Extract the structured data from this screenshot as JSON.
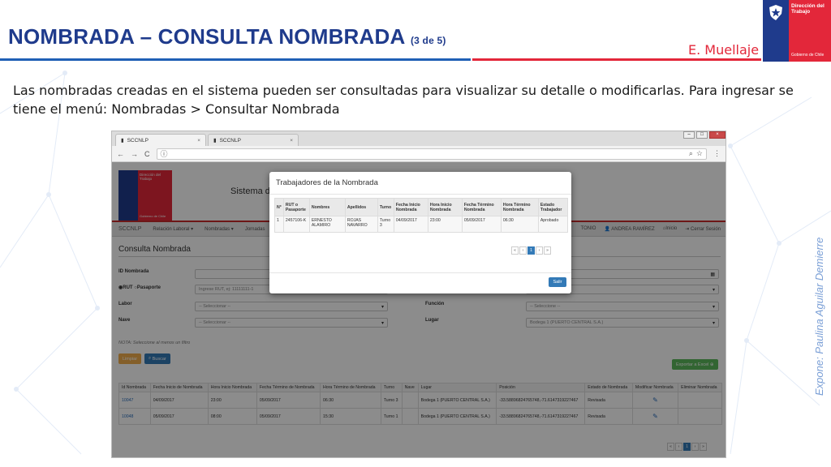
{
  "slide": {
    "title": "NOMBRADA – CONSULTA NOMBRADA",
    "title_suffix": "(3 de 5)",
    "author": "E. Muellaje",
    "logo_org_name": "Dirección del Trabajo",
    "logo_gov": "Gobierno de Chile",
    "intro_text": "Las nombradas creadas en el sistema pueden ser consultadas para visualizar su detalle o modificarlas. Para ingresar se tiene el menú: Nombradas > Consultar Nombrada",
    "side_credit": "Expone: Paulina Aguilar Demierre",
    "colors": {
      "navy": "#1f3b8c",
      "red": "#e3273a",
      "accent_blue": "#1f5fb5"
    }
  },
  "browser": {
    "tabs": [
      {
        "label": "SCCNLP",
        "close": "×"
      },
      {
        "label": "SCCNLP",
        "close": "×"
      }
    ],
    "nav_icons": {
      "back": "←",
      "forward": "→",
      "reload": "C",
      "info": "ⓘ"
    },
    "window_controls": [
      "–",
      "□",
      "×"
    ]
  },
  "app": {
    "logo_org_name": "Dirección del Trabajo",
    "logo_gov": "Gobierno de Chile",
    "title_partial": "Sistema de",
    "brand": "SCCNLP",
    "nav_items": [
      "Relación Laboral ▾",
      "Nombradas ▾",
      "Jornadas"
    ],
    "nav_right": [
      "TONIO",
      "ANDREA RAMÍREZ",
      "Inicio",
      "Cerrar Sesión"
    ],
    "section_title": "Consulta Nombrada",
    "form": {
      "id_label": "ID Nombrada",
      "rut_label": "RUT",
      "pasaporte_label": "Pasaporte",
      "rut_placeholder": "Ingrese RUT, ej: 11111111-1",
      "labor_label": "Labor",
      "labor_value": "-- Seleccionar --",
      "funcion_label": "Función",
      "funcion_value": "-- Seleccione --",
      "nave_label": "Nave",
      "nave_value": "-- Seleccionar --",
      "lugar_label": "Lugar",
      "lugar_value": "Bodega 1 (PUERTO CENTRAL S.A.)"
    },
    "note": "NOTA: Seleccione al menos un filtro",
    "buttons": {
      "limpiar": "Limpiar",
      "buscar": "Buscar",
      "exportar": "Exportar a Excel"
    },
    "grid": {
      "headers": [
        "Id Nombrada",
        "Fecha Inicio de Nombrada",
        "Hora Inicio Nombrada",
        "Fecha Término de Nombrada",
        "Hora Término de Nombrada",
        "Turno",
        "Nave",
        "Lugar",
        "Posición",
        "Estado de Nombrada",
        "Modificar Nombrada",
        "Eliminar Nombrada"
      ],
      "rows": [
        {
          "id": "10047",
          "fecha_inicio": "04/09/2017",
          "hora_inicio": "23:00",
          "fecha_termino": "05/09/2017",
          "hora_termino": "06:30",
          "turno": "Turno 3",
          "nave": "",
          "lugar": "Bodega 1 (PUERTO CENTRAL S.A.)",
          "posicion": "-33.5889682476574​8,-71.6147319227467",
          "estado": "Revisada"
        },
        {
          "id": "10048",
          "fecha_inicio": "05/09/2017",
          "hora_inicio": "08:00",
          "fecha_termino": "05/09/2017",
          "hora_termino": "15:30",
          "turno": "Turno 1",
          "nave": "",
          "lugar": "Bodega 1 (PUERTO CENTRAL S.A.)",
          "posicion": "-33.58896824765748,-71.6147319227467",
          "estado": "Revisada"
        }
      ]
    },
    "pager": [
      "«",
      "‹",
      "1",
      "›",
      "»"
    ]
  },
  "modal": {
    "title": "Trabajadores de la Nombrada",
    "headers": [
      "N°",
      "RUT o Pasaporte",
      "Nombres",
      "Apellidos",
      "Turno",
      "Fecha Inicio Nombrada",
      "Hora Inicio Nombrada",
      "Fecha Término Nombrada",
      "Hora Término Nombrada",
      "Estado Trabajador"
    ],
    "rows": [
      {
        "n": "1",
        "rut": "2457106-K",
        "nombres": "ERNESTO ALAMIRO",
        "apellidos": "ROJAS NAVARRO",
        "turno": "Turno 3",
        "fecha_inicio": "04/09/2017",
        "hora_inicio": "23:00",
        "fecha_termino": "05/09/2017",
        "hora_termino": "06:30",
        "estado": "Aprobado"
      }
    ],
    "pager": [
      "«",
      "‹",
      "1",
      "›",
      "»"
    ],
    "close_label": "Salir"
  }
}
